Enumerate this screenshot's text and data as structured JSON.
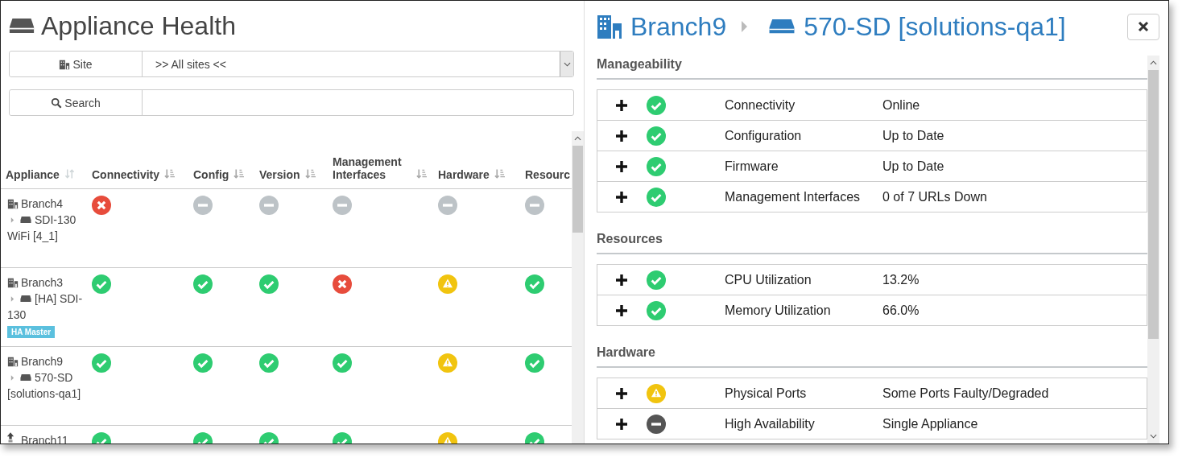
{
  "header": {
    "title": "Appliance Health"
  },
  "filters": [
    {
      "kind": "select",
      "label": "Site",
      "value": ">> All sites <<"
    },
    {
      "kind": "search",
      "label": "Search"
    }
  ],
  "table": {
    "columns": [
      {
        "label": "Appliance",
        "kind": "unsorted"
      },
      {
        "label": "Connectivity",
        "kind": "sorted"
      },
      {
        "label": "Config",
        "kind": "sorted"
      },
      {
        "label": "Version",
        "kind": "sorted"
      },
      {
        "label": "Management Interfaces",
        "kind": "sorted"
      },
      {
        "label": "Hardware",
        "kind": "sorted"
      },
      {
        "label": "Resourc",
        "kind": "plain"
      }
    ],
    "rows": [
      {
        "site": "Branch4",
        "device": "SDI-130 WiFi [4_1]",
        "statuses": [
          {
            "kind": "error"
          },
          {
            "kind": "na"
          },
          {
            "kind": "na"
          },
          {
            "kind": "na"
          },
          {
            "kind": "na"
          },
          {
            "kind": "na"
          }
        ]
      },
      {
        "site": "Branch3",
        "device": "[HA] SDI-130",
        "badge": "HA Master",
        "statuses": [
          {
            "kind": "ok"
          },
          {
            "kind": "ok"
          },
          {
            "kind": "ok"
          },
          {
            "kind": "error"
          },
          {
            "kind": "warning"
          },
          {
            "kind": "ok"
          }
        ]
      },
      {
        "site": "Branch9",
        "device": "570-SD [solutions-qa1]",
        "statuses": [
          {
            "kind": "ok"
          },
          {
            "kind": "ok"
          },
          {
            "kind": "ok"
          },
          {
            "kind": "ok"
          },
          {
            "kind": "warning"
          },
          {
            "kind": "ok"
          }
        ]
      },
      {
        "site": "Branch11",
        "statuses": [
          {
            "kind": "ok"
          },
          {
            "kind": "ok"
          },
          {
            "kind": "ok"
          },
          {
            "kind": "ok"
          },
          {
            "kind": "warning"
          },
          {
            "kind": "ok"
          }
        ]
      }
    ]
  },
  "detail": {
    "site": "Branch9",
    "device": "570-SD [solutions-qa1]",
    "sections": [
      {
        "title": "Manageability",
        "items": [
          {
            "label": "Connectivity",
            "value": "Online",
            "kind": "ok"
          },
          {
            "label": "Configuration",
            "value": "Up to Date",
            "kind": "ok"
          },
          {
            "label": "Firmware",
            "value": "Up to Date",
            "kind": "ok"
          },
          {
            "label": "Management Interfaces",
            "value": "0 of 7 URLs Down",
            "kind": "ok"
          }
        ]
      },
      {
        "title": "Resources",
        "items": [
          {
            "label": "CPU Utilization",
            "value": "13.2%",
            "kind": "ok"
          },
          {
            "label": "Memory Utilization",
            "value": "66.0%",
            "kind": "ok"
          }
        ]
      },
      {
        "title": "Hardware",
        "items": [
          {
            "label": "Physical Ports",
            "value": "Some Ports Faulty/Degraded",
            "kind": "warning"
          },
          {
            "label": "High Availability",
            "value": "Single Appliance",
            "kind": "na"
          }
        ]
      }
    ]
  }
}
